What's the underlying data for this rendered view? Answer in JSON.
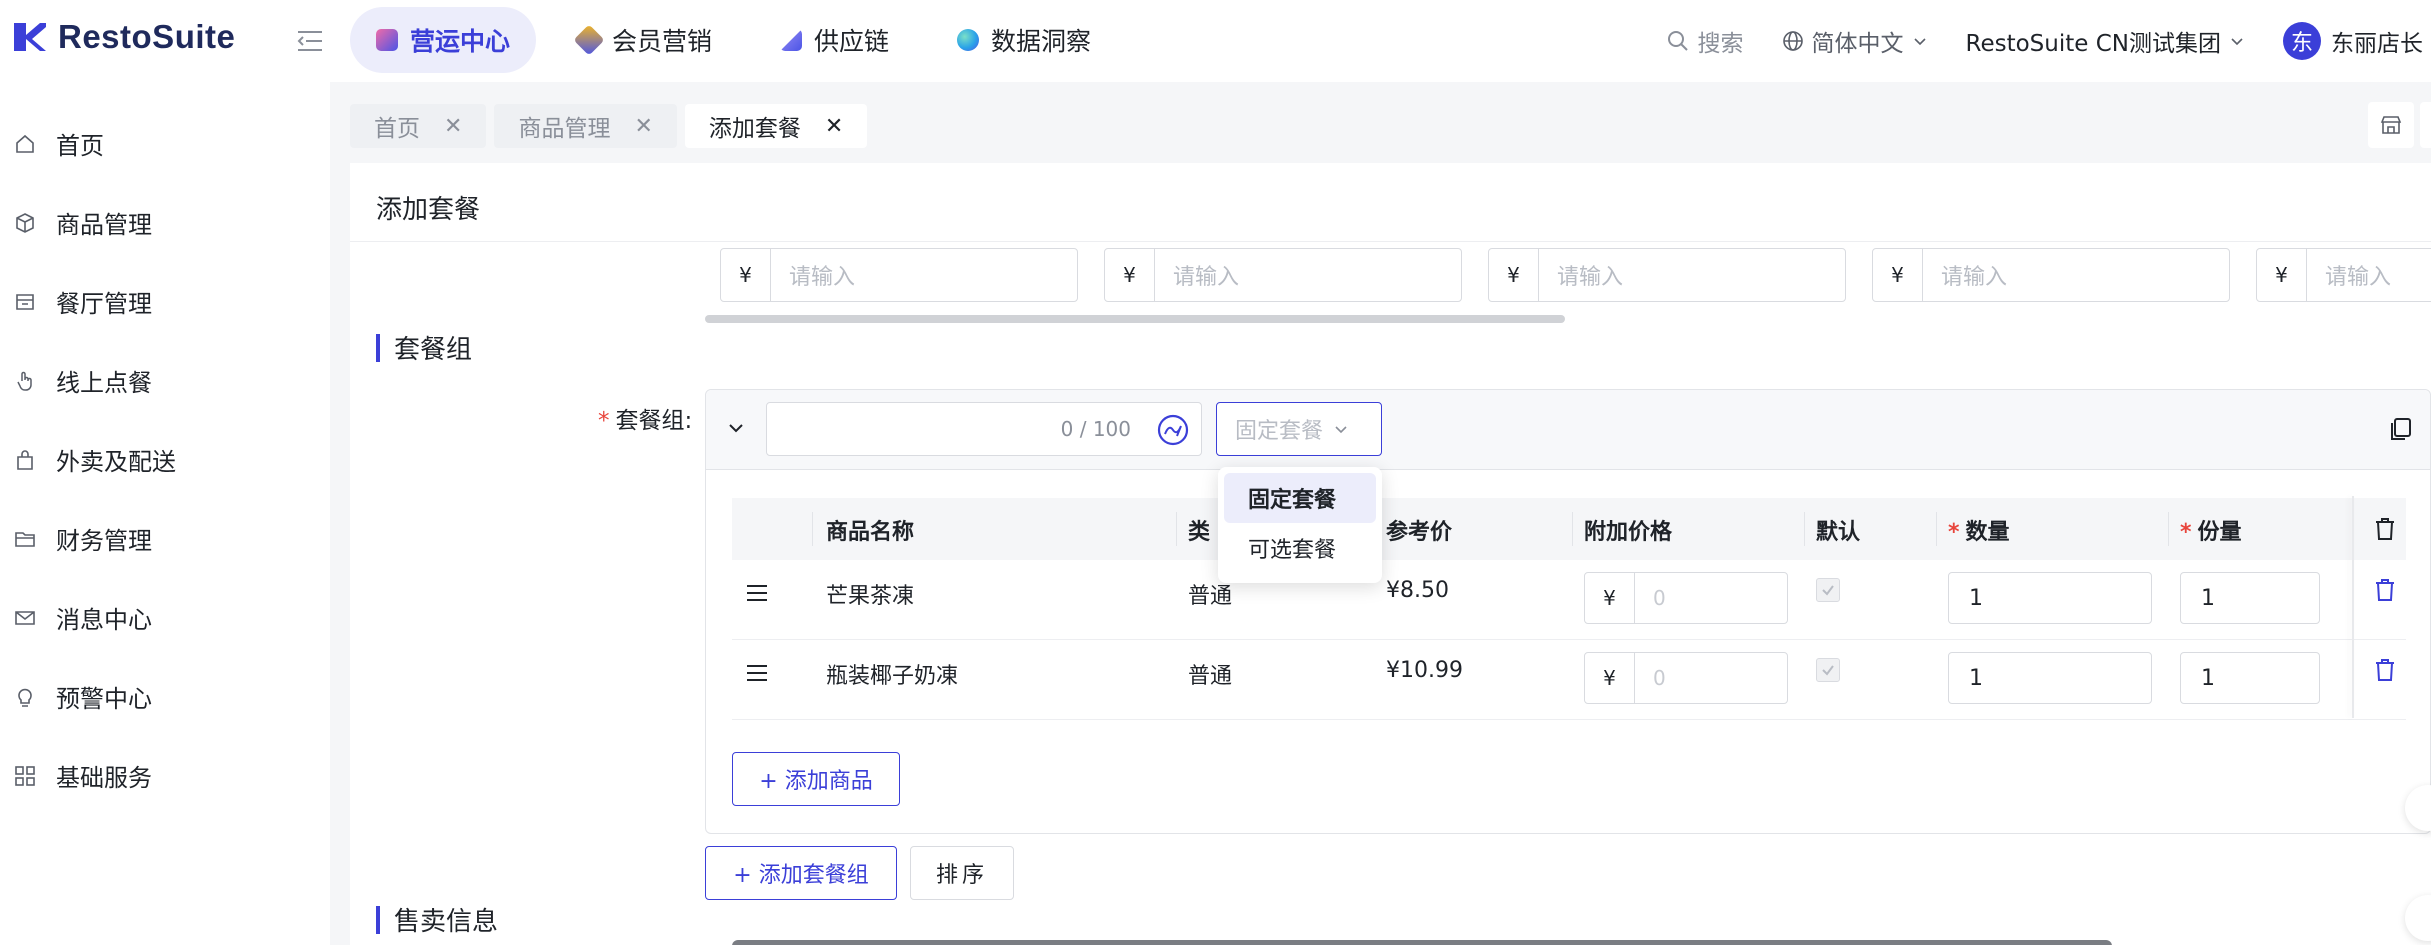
{
  "brand": {
    "name": "RestoSuite"
  },
  "topnav": {
    "items": [
      {
        "label": "营运中心",
        "active": true,
        "color": "#4b54e6"
      },
      {
        "label": "会员营销",
        "active": false,
        "color": "#f2b624"
      },
      {
        "label": "供应链",
        "active": false,
        "color": "#6a5df0"
      },
      {
        "label": "数据洞察",
        "active": false,
        "color": "#2aa3e8"
      }
    ],
    "search": "搜索",
    "language": "简体中文",
    "org": "RestoSuite CN测试集团",
    "avatar_initial": "东",
    "user": "东丽店长"
  },
  "sidebar": {
    "items": [
      {
        "label": "首页",
        "icon": "home-icon"
      },
      {
        "label": "商品管理",
        "icon": "box-icon"
      },
      {
        "label": "餐厅管理",
        "icon": "store-icon"
      },
      {
        "label": "线上点餐",
        "icon": "hand-pointer-icon"
      },
      {
        "label": "外卖及配送",
        "icon": "bag-icon"
      },
      {
        "label": "财务管理",
        "icon": "folder-icon"
      },
      {
        "label": "消息中心",
        "icon": "mail-icon"
      },
      {
        "label": "预警中心",
        "icon": "bulb-icon"
      },
      {
        "label": "基础服务",
        "icon": "grid-icon"
      }
    ]
  },
  "tabs": [
    {
      "label": "首页",
      "active": false
    },
    {
      "label": "商品管理",
      "active": false
    },
    {
      "label": "添加套餐",
      "active": true
    }
  ],
  "page": {
    "title": "添加套餐",
    "price_inputs": [
      {
        "currency": "¥",
        "placeholder": "请输入"
      },
      {
        "currency": "¥",
        "placeholder": "请输入"
      },
      {
        "currency": "¥",
        "placeholder": "请输入"
      },
      {
        "currency": "¥",
        "placeholder": "请输入"
      },
      {
        "currency": "¥",
        "placeholder": "请输入"
      }
    ],
    "section_combo": "套餐组",
    "section_sale": "售卖信息",
    "field_label": "套餐组:",
    "group": {
      "name_count": "0 / 100",
      "type_value": "固定套餐",
      "type_options": [
        {
          "label": "固定套餐",
          "selected": true
        },
        {
          "label": "可选套餐",
          "selected": false
        }
      ],
      "columns": {
        "name": "商品名称",
        "type": "类",
        "ref_price": "参考价",
        "addon_price": "附加价格",
        "default": "默认",
        "qty": "数量",
        "portion": "份量"
      },
      "rows": [
        {
          "name": "芒果茶凍",
          "type": "普通",
          "ref_price": "¥8.50",
          "addon_currency": "¥",
          "addon_placeholder": "0",
          "qty": "1",
          "portion": "1"
        },
        {
          "name": "瓶装椰子奶凍",
          "type": "普通",
          "ref_price": "¥10.99",
          "addon_currency": "¥",
          "addon_placeholder": "0",
          "qty": "1",
          "portion": "1"
        }
      ],
      "add_item_label": "+ 添加商品"
    },
    "add_group_label": "+ 添加套餐组",
    "sort_label": "排序"
  }
}
